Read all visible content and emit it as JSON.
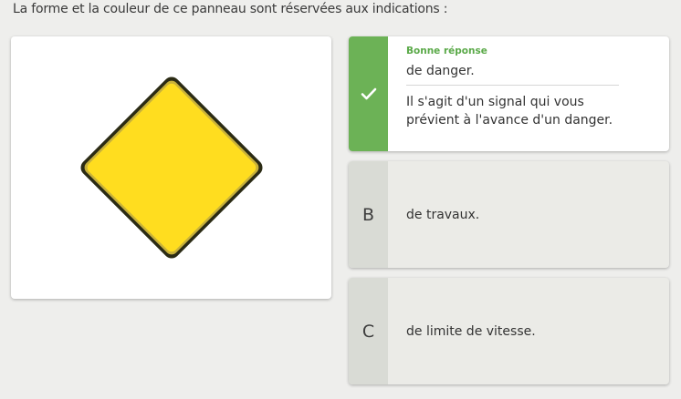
{
  "question": "La forme et la couleur de ce panneau sont réservées aux indications :",
  "sign": {
    "shape": "diamond",
    "fill_color": "#ffdd1f",
    "border_color": "#2b2b14"
  },
  "answers": [
    {
      "letter": "",
      "icon": "check-icon",
      "status_label": "Bonne réponse",
      "text": "de danger.",
      "explanation": "Il s'agit d'un signal qui vous prévient à l'avance d'un danger.",
      "correct": true
    },
    {
      "letter": "B",
      "text": "de travaux.",
      "correct": false
    },
    {
      "letter": "C",
      "text": "de limite de vitesse.",
      "correct": false
    }
  ],
  "colors": {
    "correct_accent": "#6cb256",
    "correct_label": "#5aa948"
  }
}
